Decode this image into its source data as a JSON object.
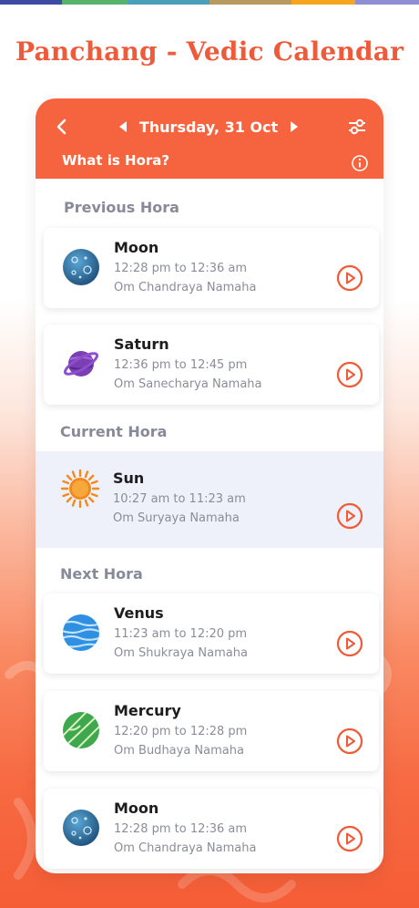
{
  "strip_colors": [
    "#3f4aa3",
    "#57b36a",
    "#4aa0b8",
    "#b69a62",
    "#f6a51f",
    "#8e8ed4"
  ],
  "headline": "Panchang - Vedic Calendar",
  "accent_color": "#f6643f",
  "header": {
    "back_icon": "chevron-left-icon",
    "date": "Thursday, 31 Oct",
    "prev_icon": "triangle-left-icon",
    "next_icon": "triangle-right-icon",
    "filter_icon": "sliders-icon",
    "hora_link": "What is Hora?",
    "info_icon": "info-icon"
  },
  "sections": {
    "previous": "Previous Hora",
    "current": "Current Hora",
    "next": "Next Hora"
  },
  "horas": {
    "previous": [
      {
        "name": "Moon",
        "time": "12:28 pm to 12:36 am",
        "mantra": "Om Chandraya Namaha",
        "icon": "moon-planet-icon"
      },
      {
        "name": "Saturn",
        "time": "12:36 pm to 12:45 pm",
        "mantra": "Om Sanecharya Namaha",
        "icon": "saturn-planet-icon"
      }
    ],
    "current": {
      "name": "Sun",
      "time": "10:27 am to 11:23 am",
      "mantra": "Om Suryaya Namaha",
      "icon": "sun-icon"
    },
    "next": [
      {
        "name": "Venus",
        "time": "11:23 am to 12:20 pm",
        "mantra": "Om Shukraya Namaha",
        "icon": "venus-planet-icon"
      },
      {
        "name": "Mercury",
        "time": "12:20 pm to 12:28 pm",
        "mantra": "Om Budhaya Namaha",
        "icon": "mercury-planet-icon"
      },
      {
        "name": "Moon",
        "time": "12:28 pm to 12:36 am",
        "mantra": "Om Chandraya Namaha",
        "icon": "moon-planet-icon"
      }
    ]
  },
  "play_icon": "play-circle-icon"
}
